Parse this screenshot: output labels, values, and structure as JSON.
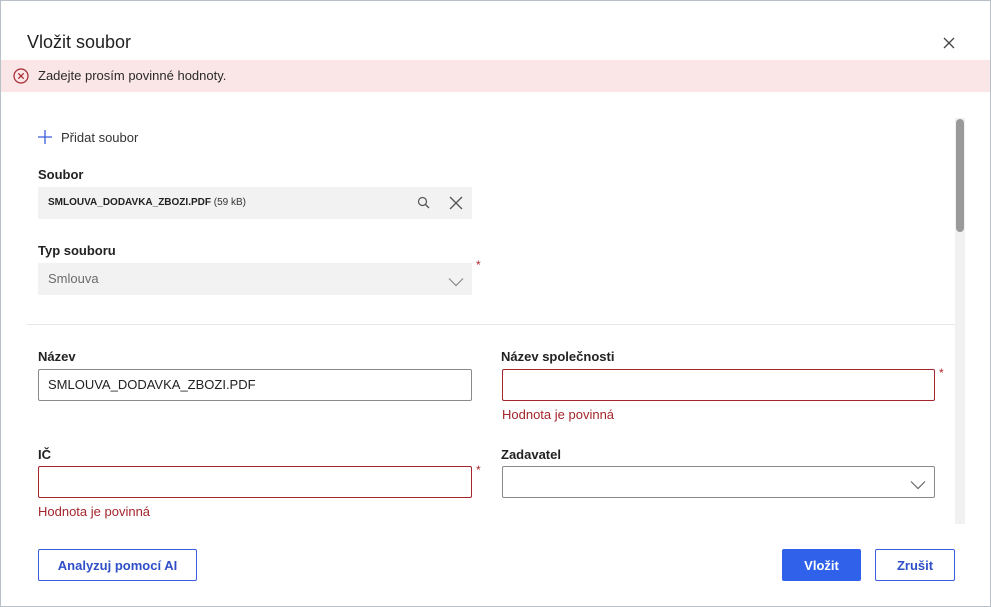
{
  "dialog": {
    "title": "Vložit soubor",
    "close_icon": "close-icon"
  },
  "error_banner": {
    "icon": "error-circle-icon",
    "text": "Zadejte prosím povinné hodnoty."
  },
  "add_file": {
    "icon": "plus-icon",
    "label": "Přidat soubor"
  },
  "file": {
    "label": "Soubor",
    "name": "SMLOUVA_DODAVKA_ZBOZI.PDF",
    "size": "(59 kB)",
    "search_icon": "search-icon",
    "clear_icon": "close-icon"
  },
  "file_type": {
    "label": "Typ souboru",
    "value": "Smlouva",
    "required_mark": "*"
  },
  "name": {
    "label": "Název",
    "value": "SMLOUVA_DODAVKA_ZBOZI.PDF"
  },
  "company_name": {
    "label": "Název společnosti",
    "value": "",
    "required_mark": "*",
    "error": "Hodnota je povinná"
  },
  "ic": {
    "label": "IČ",
    "value": "",
    "required_mark": "*",
    "error": "Hodnota je povinná"
  },
  "submitter": {
    "label": "Zadavatel",
    "value": ""
  },
  "buttons": {
    "analyze": "Analyzuj pomocí AI",
    "insert": "Vložit",
    "cancel": "Zrušit"
  },
  "colors": {
    "primary": "#2f61ea",
    "error": "#a4262c",
    "error_banner_bg": "#fbe6e7"
  }
}
